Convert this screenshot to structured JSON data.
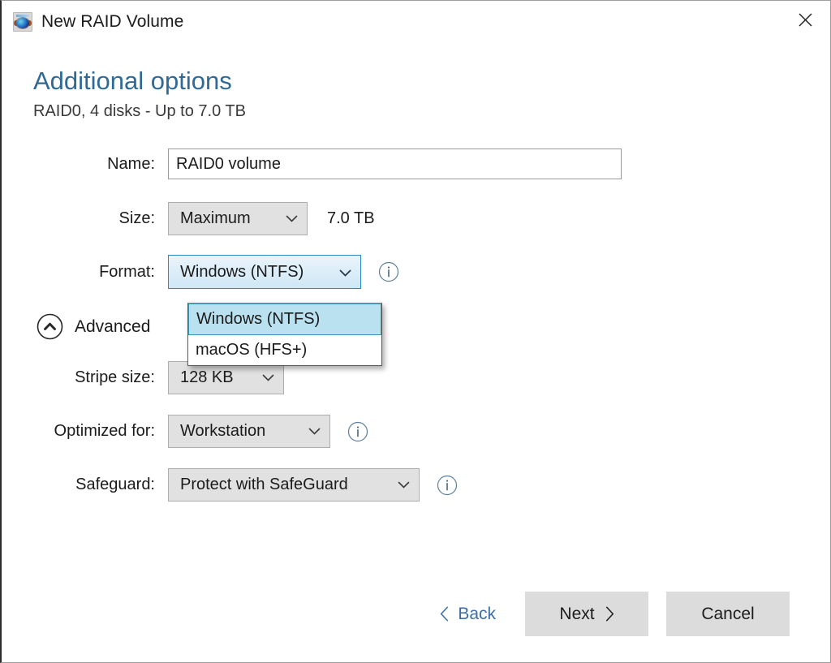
{
  "window": {
    "title": "New RAID Volume",
    "app_icon": "raid-volume-icon",
    "close_icon": "close-icon"
  },
  "header": {
    "title": "Additional options",
    "subtitle": "RAID0, 4 disks - Up to 7.0 TB",
    "title_color": "#2f6a96"
  },
  "form": {
    "name": {
      "label": "Name:",
      "value": "RAID0 volume",
      "placeholder": "Volume name"
    },
    "size": {
      "label": "Size:",
      "value": "Maximum",
      "side_value": "7.0 TB",
      "caret_icon": "chevron-down-icon"
    },
    "format": {
      "label": "Format:",
      "value": "Windows (NTFS)",
      "caret_icon": "chevron-down-icon",
      "info_icon": "info-icon",
      "expanded": true,
      "options": [
        {
          "label": "Windows (NTFS)",
          "selected": true
        },
        {
          "label": "macOS (HFS+)",
          "selected": false
        }
      ],
      "highlight_color": "#b9e1f0",
      "border_color": "#2b8ac6"
    },
    "advanced": {
      "label": "Advanced",
      "toggle_icon": "chevron-up-circle-icon",
      "expanded": true
    },
    "stripe_size": {
      "label": "Stripe size:",
      "value": "128 KB",
      "caret_icon": "chevron-down-icon"
    },
    "optimized_for": {
      "label": "Optimized for:",
      "value": "Workstation",
      "caret_icon": "chevron-down-icon",
      "info_icon": "info-icon"
    },
    "safeguard": {
      "label": "Safeguard:",
      "value": "Protect with SafeGuard",
      "caret_icon": "chevron-down-icon",
      "info_icon": "info-icon"
    }
  },
  "footer": {
    "back_label": "Back",
    "back_icon": "chevron-left-icon",
    "back_color": "#3a6ea5",
    "next_label": "Next",
    "next_icon": "chevron-right-icon",
    "cancel_label": "Cancel"
  }
}
